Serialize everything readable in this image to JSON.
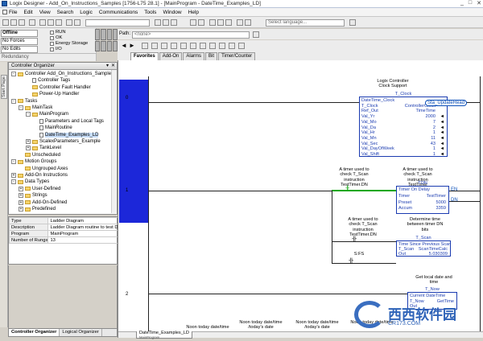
{
  "window": {
    "title": "Logix Designer - Add_On_Instructions_Samples [1756-L75 28.1] - [MainProgram - DateTime_Examples_LD]",
    "controls": [
      "_",
      "□",
      "✕"
    ]
  },
  "menu": [
    "File",
    "Edit",
    "View",
    "Search",
    "Logic",
    "Communications",
    "Tools",
    "Window",
    "Help"
  ],
  "toolbar": {
    "combo_placeholder": "Select language..."
  },
  "status_panel": {
    "mode": "Offline",
    "forces": "No Forces",
    "edits": "No Edits",
    "redundancy": "Redundancy",
    "checks": [
      "RUN",
      "OK",
      "Energy Storage",
      "I/O"
    ]
  },
  "path": {
    "label": "Path:",
    "value": "<none>"
  },
  "instruction_tabs": [
    "Favorites",
    "Add-On",
    "Alarms",
    "Bit",
    "Timer/Counter"
  ],
  "left_strip": "Start Page",
  "organizer": {
    "title": "Controller Organizer",
    "items": [
      {
        "label": "Controller Add_On_Instructions_Samples",
        "exp": "-",
        "icon": "fold",
        "indent": 0
      },
      {
        "label": "Controller Tags",
        "exp": "",
        "icon": "doc",
        "indent": 2
      },
      {
        "label": "Controller Fault Handler",
        "exp": "",
        "icon": "fold",
        "indent": 2
      },
      {
        "label": "Power-Up Handler",
        "exp": "",
        "icon": "fold",
        "indent": 2
      },
      {
        "label": "Tasks",
        "exp": "-",
        "icon": "fold",
        "indent": 0
      },
      {
        "label": "MainTask",
        "exp": "-",
        "icon": "fold",
        "indent": 1
      },
      {
        "label": "MainProgram",
        "exp": "-",
        "icon": "fold",
        "indent": 2
      },
      {
        "label": "Parameters and Local Tags",
        "exp": "",
        "icon": "doc",
        "indent": 3
      },
      {
        "label": "MainRoutine",
        "exp": "",
        "icon": "doc",
        "indent": 3
      },
      {
        "label": "DateTime_Examples_LD",
        "exp": "",
        "icon": "doc",
        "indent": 3,
        "selected": true
      },
      {
        "label": "ScalexParameters_Example",
        "exp": "+",
        "icon": "fold",
        "indent": 2
      },
      {
        "label": "TankLevel",
        "exp": "+",
        "icon": "fold",
        "indent": 2
      },
      {
        "label": "Unscheduled",
        "exp": "",
        "icon": "fold",
        "indent": 1
      },
      {
        "label": "Motion Groups",
        "exp": "-",
        "icon": "fold",
        "indent": 0
      },
      {
        "label": "Ungrouped Axes",
        "exp": "",
        "icon": "fold",
        "indent": 1
      },
      {
        "label": "Add-On Instructions",
        "exp": "+",
        "icon": "fold",
        "indent": 0
      },
      {
        "label": "Data Types",
        "exp": "-",
        "icon": "fold",
        "indent": 0
      },
      {
        "label": "User-Defined",
        "exp": "+",
        "icon": "fold",
        "indent": 1
      },
      {
        "label": "Strings",
        "exp": "+",
        "icon": "fold",
        "indent": 1
      },
      {
        "label": "Add-On-Defined",
        "exp": "+",
        "icon": "fold",
        "indent": 1
      },
      {
        "label": "Predefined",
        "exp": "+",
        "icon": "fold",
        "indent": 1
      }
    ]
  },
  "properties": [
    {
      "key": "Type",
      "value": "Ladder Diagram"
    },
    {
      "key": "Description",
      "value": "Ladder Diagram routine to test Dat"
    },
    {
      "key": "Program",
      "value": "MainProgram"
    },
    {
      "key": "Number of Rungs",
      "value": "13"
    }
  ],
  "bottom_tabs": [
    "Controller Organizer",
    "Logical Organizer"
  ],
  "ladder": {
    "rung_numbers": [
      "0",
      "1",
      "2"
    ],
    "rung0": {
      "note": "Logix Controller\nClock Support",
      "box_title": "T_Clock",
      "fields": [
        {
          "name": "DateTime_Clock",
          "value": ""
        },
        {
          "name": "T_Clock",
          "value": "ControllerClock"
        },
        {
          "name": "Ref_Out",
          "value": "TimeTime"
        },
        {
          "name": "Val_Yr",
          "value": "2000"
        },
        {
          "name": "Val_Mo",
          "value": "7"
        },
        {
          "name": "Val_Da",
          "value": "2"
        },
        {
          "name": "Val_Hr",
          "value": "1"
        },
        {
          "name": "Val_Mn",
          "value": "11"
        },
        {
          "name": "Val_Sec",
          "value": "43"
        },
        {
          "name": "Val_DayOfWeek",
          "value": "1"
        },
        {
          "name": "Val_Shift",
          "value": "1"
        }
      ],
      "output": "Sta_UpdateRead"
    },
    "rung1": {
      "note_a": "A timer used to\ncheck T_Scan\ninstruction\nTestTimer.DN",
      "note_b": "A timer used to\ncheck T_Scan\ninstruction\nTestTimer",
      "ton": {
        "title": "TON",
        "fields": [
          {
            "name": "Timer On Delay",
            "value": ""
          },
          {
            "name": "Timer",
            "value": "TestTimer"
          },
          {
            "name": "Preset",
            "value": "5000"
          },
          {
            "name": "Accum",
            "value": "3359"
          }
        ],
        "en": "EN",
        "dn": "DN"
      },
      "note_c": "A timer used to\ncheck T_Scan\ninstruction\nTestTimer.DN",
      "note_d": "Determine time\nbetween timer DN\nbits",
      "scan": {
        "title": "T_Scan",
        "fields": [
          {
            "name": "Time Since Previous Scan",
            "value": ""
          },
          {
            "name": "T_Scan",
            "value": "ScanTimeCalc"
          },
          {
            "name": "Out",
            "value": "5.030309"
          }
        ]
      },
      "sfs": "S:FS"
    },
    "rung2": {
      "note": "Get local date and\ntime",
      "box_title": "T_Now",
      "fields": [
        {
          "name": "Current DateTime",
          "value": ""
        },
        {
          "name": "T_Now",
          "value": "GetTime"
        },
        {
          "name": "Out",
          "value": ""
        }
      ]
    },
    "footnotes": [
      "Noon today date/time",
      "Noon today date/time\n/today's date",
      "Noon today date/time\n/today's date",
      "Noon today date/time"
    ],
    "routine_tab": "DateTime_Examples_LD",
    "routine_tab_sub": "MainProgram"
  },
  "watermark": {
    "text": "西西软件园",
    "url": "CR173.COM"
  }
}
